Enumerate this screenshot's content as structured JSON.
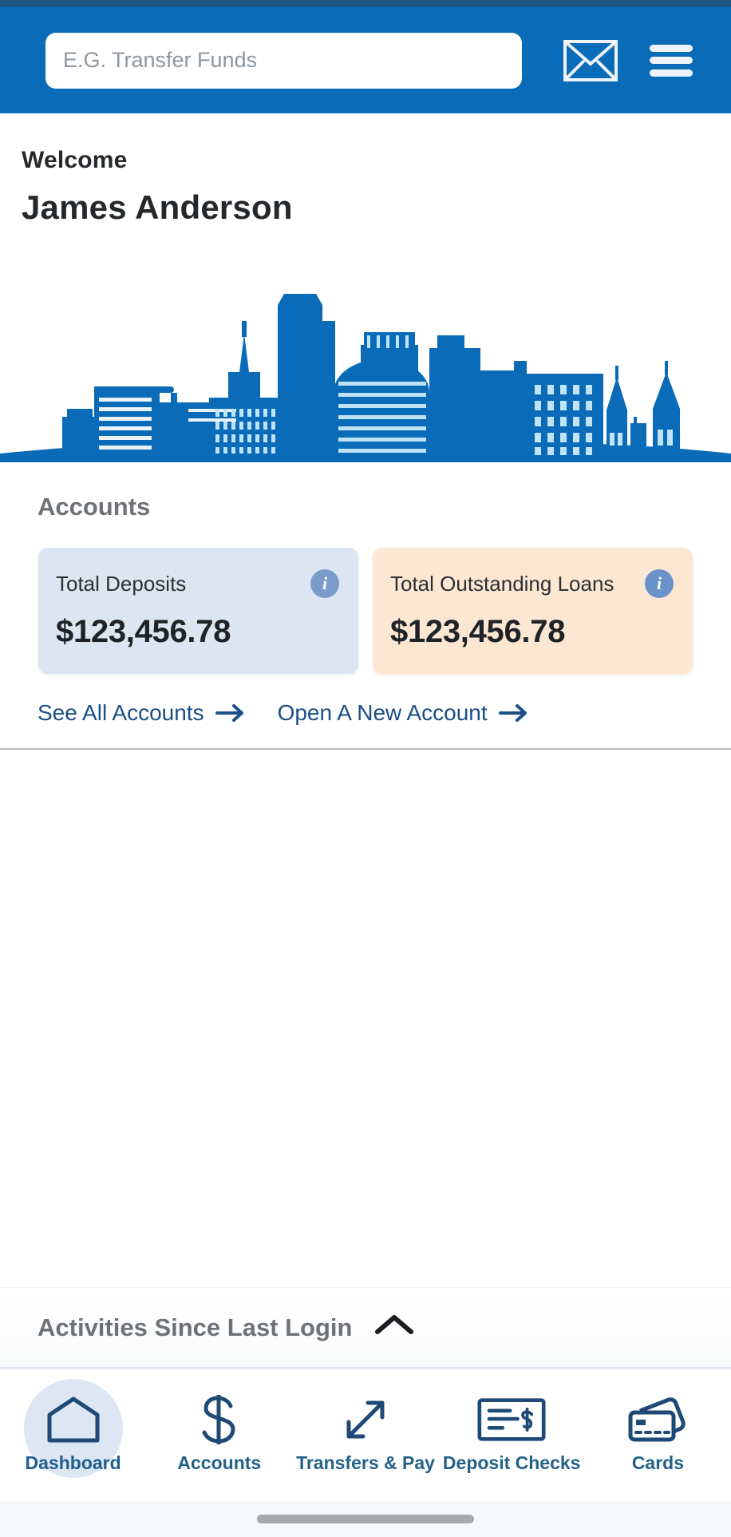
{
  "header": {
    "search_placeholder": "E.G. Transfer Funds",
    "search_value": "",
    "mail_icon": "envelope-icon",
    "menu_icon": "hamburger-menu-icon",
    "background_color": "#0a6cb8"
  },
  "welcome": {
    "greeting": "Welcome",
    "user_name": "James Anderson"
  },
  "hero": {
    "illustration": "city-skyline-illustration",
    "color": "#0a6cb8"
  },
  "accounts": {
    "title": "Accounts",
    "cards": [
      {
        "label": "Total Deposits",
        "amount": "$123,456.78",
        "info_icon": "info-icon",
        "background_color": "#dbe6f2"
      },
      {
        "label": "Total Outstanding Loans",
        "amount": "$123,456.78",
        "info_icon": "info-icon",
        "background_color": "#fce7d2"
      }
    ],
    "links": [
      {
        "label": "See All Accounts",
        "icon": "arrow-right-icon"
      },
      {
        "label": "Open A New Account",
        "icon": "arrow-right-icon"
      }
    ]
  },
  "activities": {
    "title": "Activities Since Last Login",
    "toggle_icon": "chevron-up-icon"
  },
  "bottom_nav": {
    "items": [
      {
        "label": "Dashboard",
        "icon": "home-icon",
        "active": true
      },
      {
        "label": "Accounts",
        "icon": "dollar-sign-icon",
        "active": false
      },
      {
        "label": "Transfers & Pay",
        "icon": "diagonal-arrows-icon",
        "active": false
      },
      {
        "label": "Deposit Checks",
        "icon": "check-document-icon",
        "active": false
      },
      {
        "label": "Cards",
        "icon": "credit-cards-icon",
        "active": false
      }
    ],
    "active_highlight_color": "#dde6f3",
    "label_color": "#226188"
  }
}
